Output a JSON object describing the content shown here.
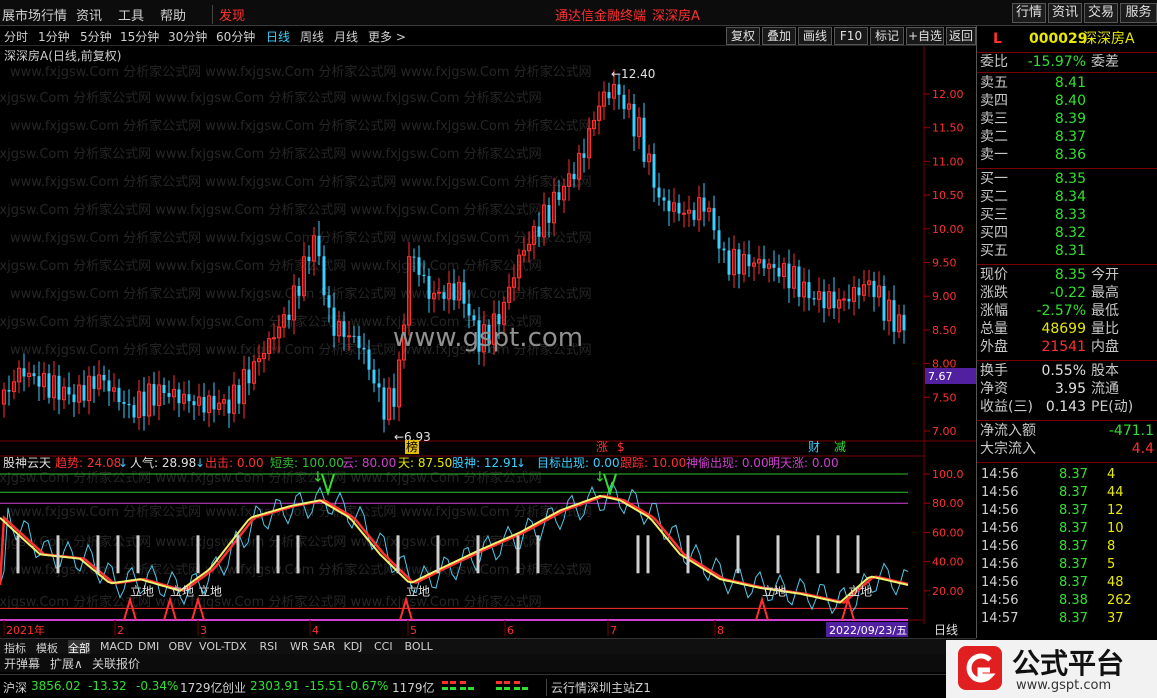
{
  "menu": {
    "items": [
      "展市场行情",
      "资讯",
      "工具",
      "帮助"
    ],
    "discover": "发现",
    "center_title": "通达信金融终端",
    "stock_title": "深深房A",
    "right_buttons": [
      "行情",
      "资讯",
      "交易",
      "服务"
    ]
  },
  "toolbar": {
    "timeframes": [
      "分时",
      "1分钟",
      "5分钟",
      "15分钟",
      "30分钟",
      "60分钟",
      "日线",
      "周线",
      "月线",
      "更多 >"
    ],
    "active": "日线",
    "buttons": [
      "复权",
      "叠加",
      "画线",
      "F10",
      "标记",
      "+自选",
      "返回"
    ]
  },
  "main_chart": {
    "title": "深深房A(日线,前复权)",
    "watermark": "www.fxjgsw.Com 分析家公式网",
    "site_watermark": "www.gspt.com",
    "high_label": "12.40",
    "low_label": "6.93",
    "price_axis": [
      "12.00",
      "11.50",
      "11.00",
      "10.50",
      "10.00",
      "9.50",
      "9.00",
      "8.50",
      "8.00",
      "7.50",
      "7.00"
    ],
    "last_price_tag": "7.67",
    "markers": [
      "榜",
      "涨",
      "$",
      "财",
      "减"
    ]
  },
  "indicator": {
    "name": "股神云天",
    "items": [
      {
        "label": "趋势: 24.08",
        "color": "#ff3030"
      },
      {
        "label": "人气: 28.98",
        "color": "#e0e0e0"
      },
      {
        "label": "出击: 0.00",
        "color": "#ff3030"
      },
      {
        "label": "短卖: 100.00",
        "color": "#30c030"
      },
      {
        "label": "云: 80.00",
        "color": "#d040d0"
      },
      {
        "label": "天: 87.50",
        "color": "#e8e800"
      },
      {
        "label": "股神: 12.91",
        "color": "#3ad0ff"
      },
      {
        "label": "目标出现: 0.00",
        "color": "#3ad0ff"
      },
      {
        "label": "跟踪: 10.00",
        "color": "#ff3030"
      },
      {
        "label": "神偷出现: 0.00",
        "color": "#d040d0"
      },
      {
        "label": "明天涨: 0.00",
        "color": "#d040d0"
      }
    ],
    "axis": [
      "100.0",
      "80.00",
      "60.00",
      "40.00",
      "20.00"
    ],
    "lidi_label": "立地",
    "date_axis": [
      "2021年",
      "2",
      "3",
      "4",
      "5",
      "6",
      "7",
      "8"
    ],
    "date_tag": "2022/09/23/五",
    "period": "日线"
  },
  "quote": {
    "code": "000029",
    "name": "深深房A",
    "corner": "L",
    "weibi_label": "委比",
    "weibi": "-15.97%",
    "weicha_label": "委差",
    "sell": [
      {
        "label": "卖五",
        "price": "8.41"
      },
      {
        "label": "卖四",
        "price": "8.40"
      },
      {
        "label": "卖三",
        "price": "8.39"
      },
      {
        "label": "卖二",
        "price": "8.37"
      },
      {
        "label": "卖一",
        "price": "8.36"
      }
    ],
    "buy": [
      {
        "label": "买一",
        "price": "8.35"
      },
      {
        "label": "买二",
        "price": "8.34"
      },
      {
        "label": "买三",
        "price": "8.33"
      },
      {
        "label": "买四",
        "price": "8.32"
      },
      {
        "label": "买五",
        "price": "8.31"
      }
    ],
    "stats": [
      {
        "label": "现价",
        "value": "8.35",
        "label2": "今开",
        "color": "#30e030"
      },
      {
        "label": "涨跌",
        "value": "-0.22",
        "label2": "最高",
        "color": "#30e030"
      },
      {
        "label": "涨幅",
        "value": "-2.57%",
        "label2": "最低",
        "color": "#30e030"
      },
      {
        "label": "总量",
        "value": "48699",
        "label2": "量比",
        "color": "#e8e800"
      },
      {
        "label": "外盘",
        "value": "21541",
        "label2": "内盘",
        "color": "#ff3030"
      }
    ],
    "stats2": [
      {
        "label": "换手",
        "value": "0.55%",
        "label2": "股本"
      },
      {
        "label": "净资",
        "value": "3.95",
        "label2": "流通"
      },
      {
        "label": "收益(三)",
        "value": "0.143",
        "label2": "PE(动)"
      }
    ],
    "flow": [
      {
        "label": "净流入额",
        "value": "-471.1",
        "color": "#30e030"
      },
      {
        "label": "大宗流入",
        "value": "4.4",
        "color": "#ff3030"
      }
    ],
    "ticks": [
      {
        "time": "14:56",
        "price": "8.37",
        "vol": "4"
      },
      {
        "time": "14:56",
        "price": "8.37",
        "vol": "44"
      },
      {
        "time": "14:56",
        "price": "8.37",
        "vol": "12"
      },
      {
        "time": "14:56",
        "price": "8.37",
        "vol": "10"
      },
      {
        "time": "14:56",
        "price": "8.37",
        "vol": "8"
      },
      {
        "time": "14:56",
        "price": "8.37",
        "vol": "5"
      },
      {
        "time": "14:56",
        "price": "8.37",
        "vol": "48"
      },
      {
        "time": "14:56",
        "price": "8.38",
        "vol": "262"
      },
      {
        "time": "14:57",
        "price": "8.37",
        "vol": "37"
      }
    ]
  },
  "indicator_tabs": [
    "指标",
    "模板",
    "全部",
    "MACD",
    "DMI",
    "OBV",
    "VOL-TDX",
    "RSI",
    "WR",
    "SAR",
    "KDJ",
    "CCI",
    "BOLL"
  ],
  "active_tab": "全部",
  "sub_tabs": [
    "开弹幕",
    "扩展∧",
    "关联报价"
  ],
  "status": {
    "sh_label": "沪深",
    "sh_val": "3856.02",
    "sh_chg": "-13.32",
    "sh_pct": "-0.34%",
    "sh_amt": "1729亿",
    "cy_label": "创业",
    "cy_val": "2303.91",
    "cy_chg": "-15.51",
    "cy_pct": "-0.67%",
    "cy_amt": "1179亿",
    "server": "云行情深圳主站Z1"
  },
  "logo": {
    "text": "公式平台",
    "url": "www.gspt.com"
  },
  "colors": {
    "up": "#ff3030",
    "down": "#3ad0ff",
    "ma_yellow": "#f0f070",
    "green": "#30e030"
  }
}
